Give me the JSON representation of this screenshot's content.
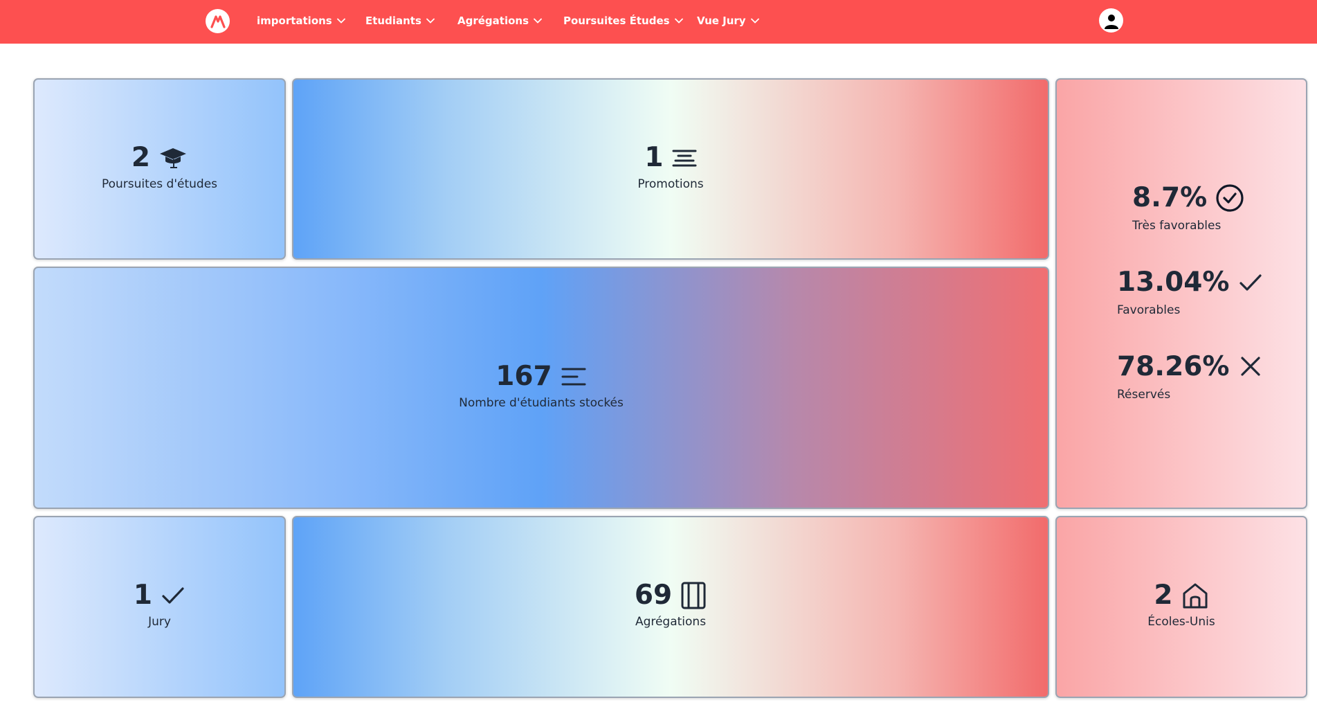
{
  "nav": {
    "logo_icon": "app-logo",
    "items": [
      {
        "label": "importations"
      },
      {
        "label": "Etudiants"
      },
      {
        "label": "Agrégations"
      },
      {
        "label": "Poursuites Études"
      },
      {
        "label": "Vue Jury"
      }
    ],
    "avatar_icon": "user-icon",
    "background": "#fd5050"
  },
  "cards": {
    "poursuites": {
      "value": "2",
      "label": "Poursuites d'études",
      "icon": "graduation-cap-icon"
    },
    "promotions": {
      "value": "1",
      "label": "Promotions",
      "icon": "align-center-icon"
    },
    "etudiants": {
      "value": "167",
      "label": "Nombre d'étudiants stockés",
      "icon": "align-left-icon"
    },
    "jury": {
      "value": "1",
      "label": "Jury",
      "icon": "check-icon"
    },
    "agregations": {
      "value": "69",
      "label": "Agrégations",
      "icon": "notebook-icon"
    },
    "ecoles": {
      "value": "2",
      "label": "Écoles-Unis",
      "icon": "home-icon"
    }
  },
  "avis": {
    "tres_favorables": {
      "value": "8.7%",
      "label": "Très favorables",
      "icon": "check-circle-icon"
    },
    "favorables": {
      "value": "13.04%",
      "label": "Favorables",
      "icon": "check-icon"
    },
    "reserves": {
      "value": "78.26%",
      "label": "Réservés",
      "icon": "x-icon"
    }
  }
}
